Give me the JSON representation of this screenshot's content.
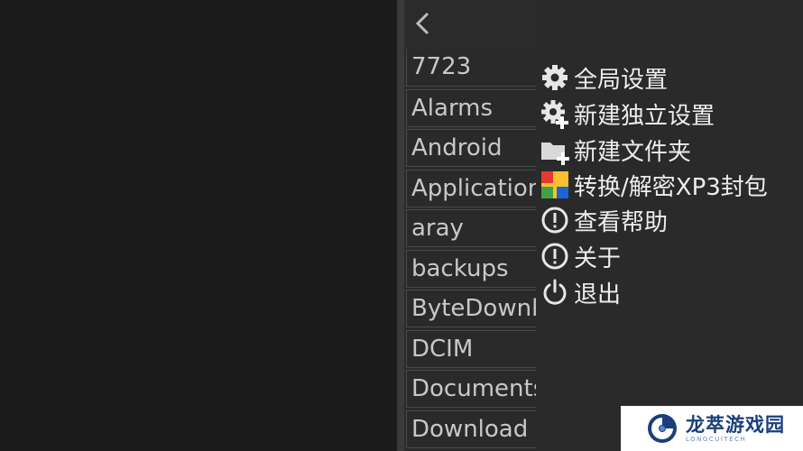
{
  "file_list": {
    "items": [
      {
        "label": "7723"
      },
      {
        "label": "Alarms"
      },
      {
        "label": "Android"
      },
      {
        "label": "Applications"
      },
      {
        "label": "aray"
      },
      {
        "label": "backups"
      },
      {
        "label": "ByteDownload"
      },
      {
        "label": "DCIM"
      },
      {
        "label": "Documents"
      },
      {
        "label": "Download"
      }
    ]
  },
  "menu": {
    "items": [
      {
        "label": "全局设置",
        "icon": "gear-icon"
      },
      {
        "label": "新建独立设置",
        "icon": "gear-plus-icon"
      },
      {
        "label": "新建文件夹",
        "icon": "folder-plus-icon"
      },
      {
        "label": "转换/解密XP3封包",
        "icon": "colored-package-icon"
      },
      {
        "label": "查看帮助",
        "icon": "exclamation-circle-icon"
      },
      {
        "label": "关于",
        "icon": "exclamation-circle-icon"
      },
      {
        "label": "退出",
        "icon": "power-icon"
      }
    ]
  },
  "watermark": {
    "title": "龙萃游戏园",
    "subtitle": "LONGCUITECH"
  },
  "colors": {
    "background": "#1c1c1c",
    "list_bg": "#2b2b2b",
    "menu_bg": "#2a2a2a",
    "text": "#ededed"
  }
}
